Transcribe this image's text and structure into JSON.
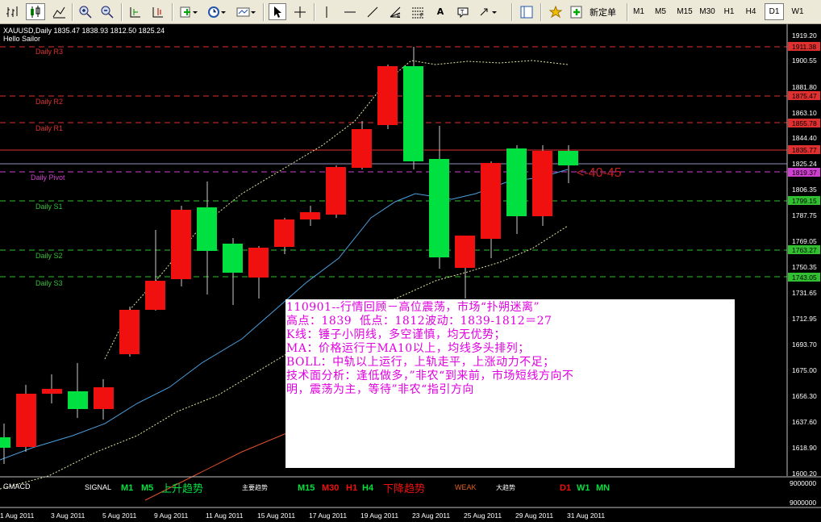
{
  "toolbar": {
    "new_order_label": "新定单",
    "timeframes": [
      "M1",
      "M5",
      "M15",
      "M30",
      "H1",
      "H4",
      "D1",
      "W1"
    ],
    "active_timeframe": "D1"
  },
  "chart": {
    "header": "XAUUSD,Daily  1835.47 1838.93 1812.50 1825.24",
    "indicator_name": "Hello Sailor",
    "pivot_labels": {
      "r3": "Daily R3",
      "r2": "Daily R2",
      "r1": "Daily R1",
      "pivot": "Daily Pivot",
      "s1": "Daily S1",
      "s2": "Daily S2",
      "s3": "Daily S3"
    },
    "pivot_colors": {
      "r": "#e03030",
      "pivot": "#d040d0",
      "s": "#30c030"
    },
    "price_ticks": [
      "1919.20",
      "1900.55",
      "1881.80",
      "1863.10",
      "1844.40",
      "1825.24",
      "1806.35",
      "1787.75",
      "1769.05",
      "1750.35",
      "1731.65",
      "1712.95",
      "1693.70",
      "1675.00",
      "1656.30",
      "1637.60",
      "1618.90",
      "1600.20"
    ],
    "level_tags": [
      "1911.38",
      "1875.47",
      "1855.78",
      "1835.77",
      "1819.37",
      "1799.15",
      "1763.27",
      "1743.05"
    ],
    "annotation": "<-40-45",
    "date_labels": [
      "1 Aug 2011",
      "3 Aug 2011",
      "5 Aug 2011",
      "9 Aug 2011",
      "11 Aug 2011",
      "15 Aug 2011",
      "17 Aug 2011",
      "19 Aug 2011",
      "23 Aug 2011",
      "25 Aug 2011",
      "29 Aug 2011",
      "31 Aug 2011"
    ]
  },
  "sub": {
    "name": "GMACD",
    "signal": "SIGNAL",
    "m1": "M1",
    "m5": "M5",
    "up_trend": "上升趋势",
    "main_trend": "主要趋势",
    "m15": "M15",
    "m30": "M30",
    "h1": "H1",
    "h4": "H4",
    "down_trend": "下降趋势",
    "weak": "WEAK",
    "big_trend": "大趋势",
    "d1": "D1",
    "w1": "W1",
    "mn": "MN",
    "scale_top": "9000000",
    "scale_bottom": "9000000"
  },
  "info": {
    "lines": [
      "110901--行情回顾－高位震荡，市场“扑朔迷离”",
      "高点：1839  低点：1812波动：1839-1812＝27",
      "K线：锤子小阴线，多空谨慎，均无优势；",
      "MA：价格运行于MA10以上，均线多头排列；",
      "BOLL：中轨以上运行，上轨走平，上涨动力不足；",
      "技术面分析：逢低做多，”非农“到来前，市场短线方向不",
      "明，震荡为主，等待”非农“指引方向"
    ]
  }
}
